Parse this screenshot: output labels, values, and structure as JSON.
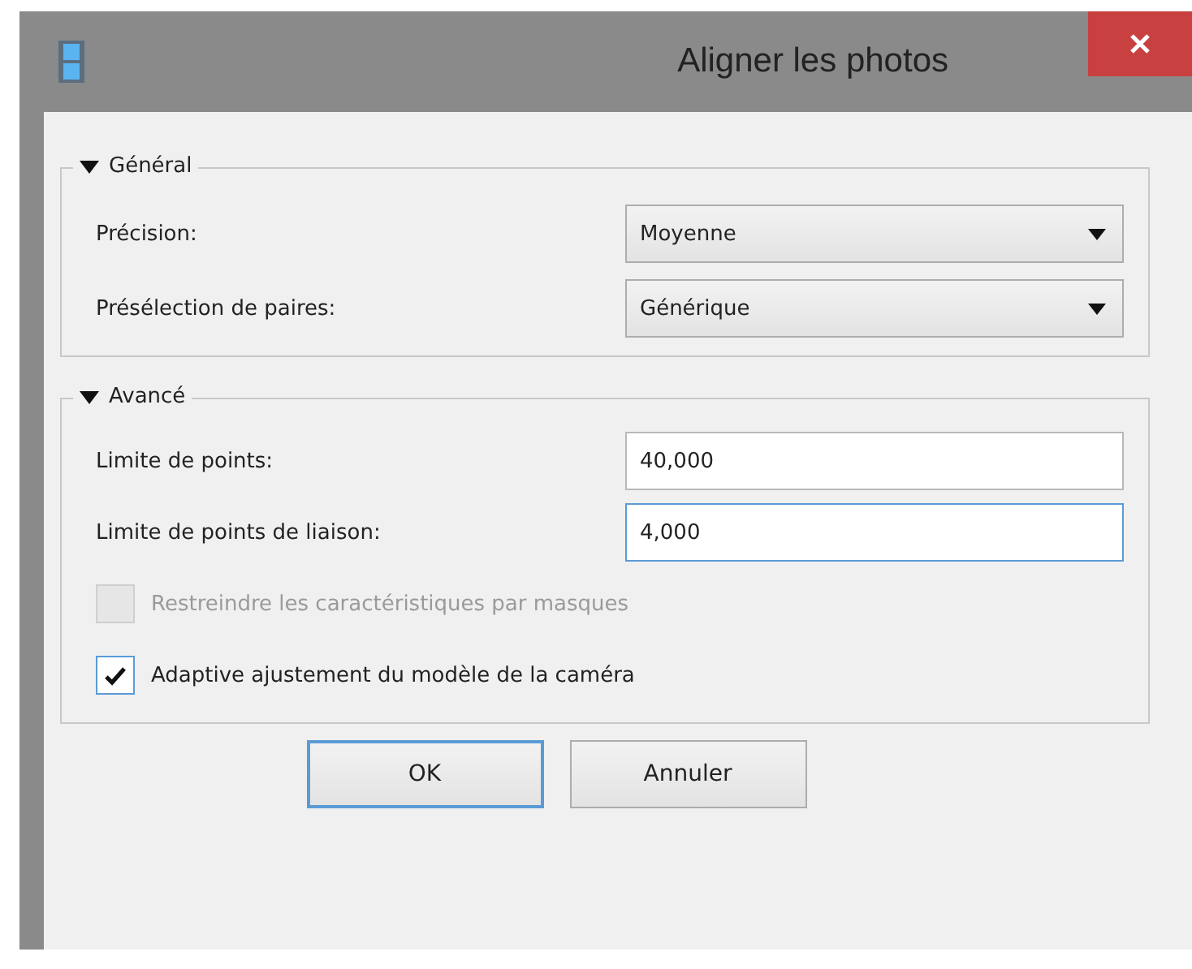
{
  "window": {
    "title": "Aligner les photos"
  },
  "groups": [
    {
      "title": "Général",
      "expanded": true,
      "rows": [
        {
          "kind": "combo",
          "label": "Précision:",
          "value": "Moyenne",
          "focused": false
        },
        {
          "kind": "combo",
          "label": "Présélection de paires:",
          "value": "Générique",
          "focused": false
        }
      ]
    },
    {
      "title": "Avancé",
      "expanded": true,
      "rows": [
        {
          "kind": "field",
          "label": "Limite de points:",
          "value": "40,000",
          "focused": false
        },
        {
          "kind": "field",
          "label": "Limite de points de liaison:",
          "value": "4,000",
          "focused": true
        },
        {
          "kind": "checkbox",
          "label": "Restreindre les caractéristiques par masques",
          "checked": false,
          "disabled": true
        },
        {
          "kind": "checkbox",
          "label": "Adaptive ajustement du modèle de la caméra",
          "checked": true,
          "disabled": false
        }
      ]
    }
  ],
  "buttons": [
    {
      "label": "OK",
      "default": true
    },
    {
      "label": "Annuler",
      "default": false
    }
  ]
}
